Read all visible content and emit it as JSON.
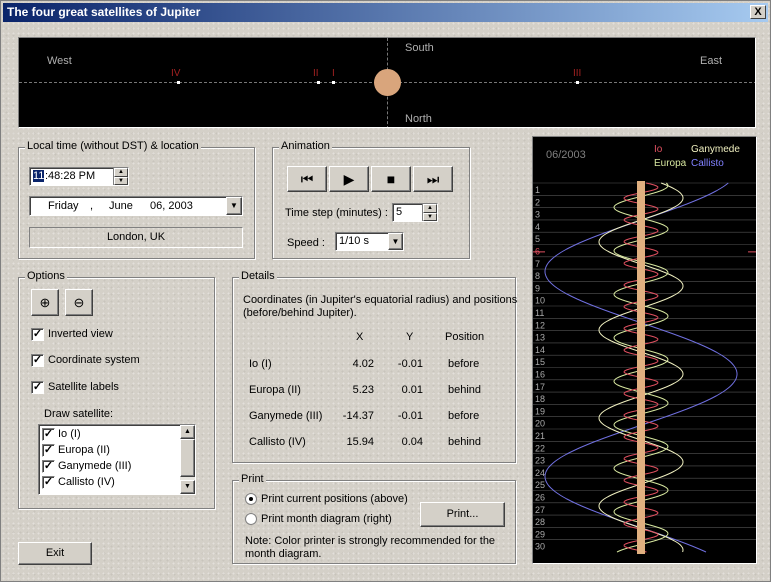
{
  "window": {
    "title": "The four great satellites of Jupiter",
    "close_label": "X"
  },
  "sky": {
    "west": "West",
    "east": "East",
    "south": "South",
    "north": "North",
    "labels": [
      {
        "text": "IV",
        "satellite": "Callisto"
      },
      {
        "text": "II",
        "satellite": "Europa"
      },
      {
        "text": "I",
        "satellite": "Io"
      },
      {
        "text": "III",
        "satellite": "Ganymede"
      }
    ]
  },
  "local_time": {
    "title": "Local time (without DST) & location",
    "time": "11:48:28 PM",
    "time_selected": "11",
    "time_rest": ":48:28 PM",
    "date_weekday": "Friday",
    "date_sep": ",",
    "date_month": "June",
    "date_day_year": "06, 2003",
    "location": "London, UK"
  },
  "animation": {
    "title": "Animation",
    "time_step_label": "Time step (minutes) :",
    "time_step_value": "5",
    "speed_label": "Speed :",
    "speed_value": "1/10 s"
  },
  "options": {
    "title": "Options",
    "inverted_view": "Inverted view",
    "coordinate_system": "Coordinate system",
    "satellite_labels": "Satellite labels",
    "draw_satellite_label": "Draw satellite:",
    "satellites": [
      "Io (I)",
      "Europa (II)",
      "Ganymede (III)",
      "Callisto (IV)"
    ]
  },
  "details": {
    "title": "Details",
    "description_line1": "Coordinates (in Jupiter's equatorial radius) and positions",
    "description_line2": "(before/behind Jupiter).",
    "headers": {
      "x": "X",
      "y": "Y",
      "position": "Position"
    },
    "rows": [
      {
        "name": "Io (I)",
        "x": "4.02",
        "y": "-0.01",
        "position": "before"
      },
      {
        "name": "Europa (II)",
        "x": "5.23",
        "y": "0.01",
        "position": "behind"
      },
      {
        "name": "Ganymede (III)",
        "x": "-14.37",
        "y": "-0.01",
        "position": "before"
      },
      {
        "name": "Callisto (IV)",
        "x": "15.94",
        "y": "0.04",
        "position": "behind"
      }
    ]
  },
  "print": {
    "title": "Print",
    "option_current": "Print current positions (above)",
    "option_month": "Print month diagram (right)",
    "button": "Print...",
    "note_line1": "Note: Color printer is strongly recommended for the",
    "note_line2": "month diagram."
  },
  "exit_button": "Exit",
  "month_diagram": {
    "month": "06/2003",
    "legend": {
      "io": "Io",
      "ganymede": "Ganymede",
      "europa": "Europa",
      "callisto": "Callisto"
    },
    "days": [
      "1",
      "2",
      "3",
      "4",
      "5",
      "6",
      "7",
      "8",
      "9",
      "10",
      "11",
      "12",
      "13",
      "14",
      "15",
      "16",
      "17",
      "18",
      "19",
      "20",
      "21",
      "22",
      "23",
      "24",
      "25",
      "26",
      "27",
      "28",
      "29",
      "30"
    ],
    "current_day": 6,
    "colors": {
      "io": "#e05060",
      "europa": "#d8e8a0",
      "ganymede": "#f0f0c0",
      "callisto": "#7070e0",
      "jupiter": "#e0b080"
    }
  }
}
